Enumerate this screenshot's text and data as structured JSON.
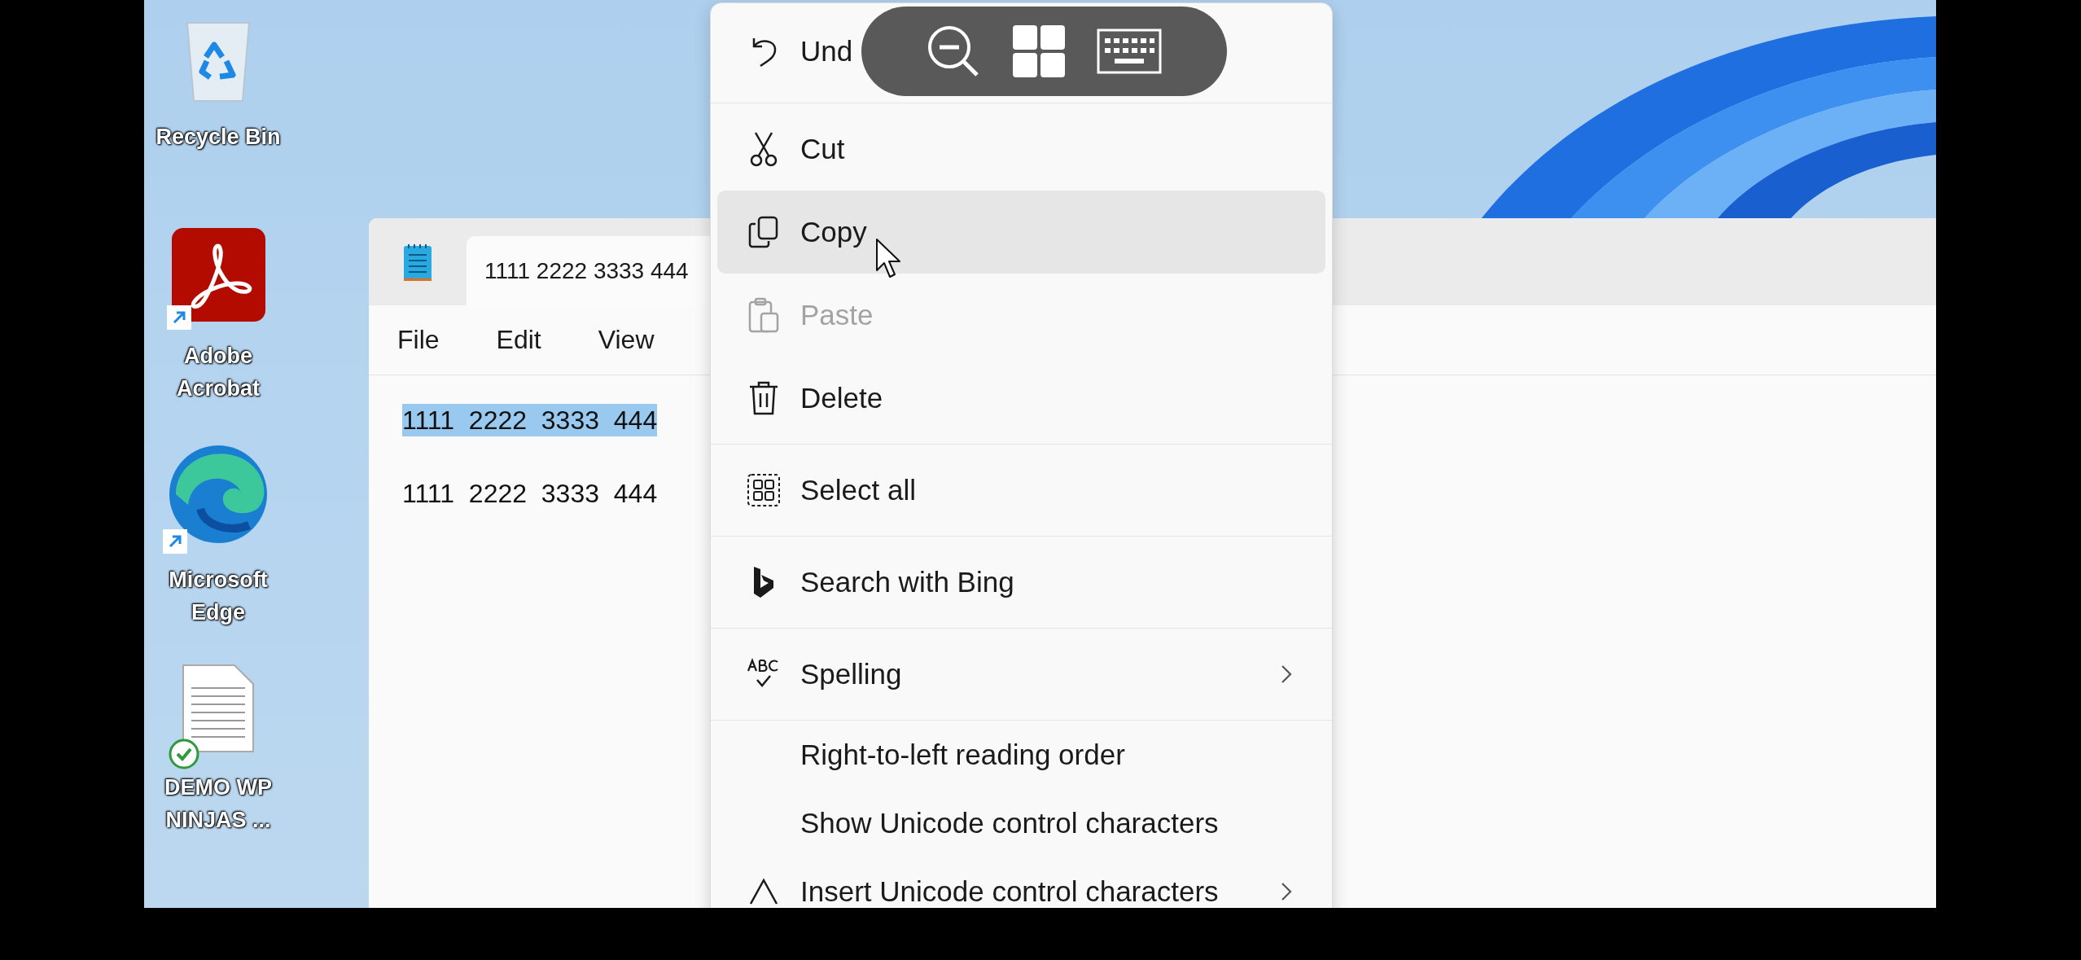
{
  "desktop": {
    "icons": [
      {
        "label": "Recycle Bin"
      },
      {
        "label": "Adobe Acrobat"
      },
      {
        "label": "Microsoft Edge"
      },
      {
        "label": "DEMO WP NINJAS ..."
      }
    ]
  },
  "notepad": {
    "tabs": [
      {
        "label": "1111 2222 3333 444",
        "selected": true
      }
    ],
    "menu": [
      "File",
      "Edit",
      "View"
    ],
    "lines": [
      {
        "text": "1111  2222  3333  444",
        "selected": true
      },
      {
        "text": "1111  2222  3333  444",
        "selected": false
      }
    ]
  },
  "context_menu": {
    "groups": [
      [
        {
          "label": "Und",
          "selected": false,
          "disabled": false,
          "submenu": false
        }
      ],
      [
        {
          "label": "Cut",
          "selected": false,
          "disabled": false,
          "submenu": false
        },
        {
          "label": "Copy",
          "selected": true,
          "disabled": false,
          "submenu": false
        },
        {
          "label": "Paste",
          "selected": false,
          "disabled": true,
          "submenu": false
        },
        {
          "label": "Delete",
          "selected": false,
          "disabled": false,
          "submenu": false
        }
      ],
      [
        {
          "label": "Select all",
          "selected": false,
          "disabled": false,
          "submenu": false
        }
      ],
      [
        {
          "label": "Search with Bing",
          "selected": false,
          "disabled": false,
          "submenu": false
        }
      ],
      [
        {
          "label": "Spelling",
          "selected": false,
          "disabled": false,
          "submenu": true
        }
      ],
      [
        {
          "label": "Right-to-left reading order",
          "selected": false,
          "disabled": false,
          "submenu": false
        },
        {
          "label": "Show Unicode control characters",
          "selected": false,
          "disabled": false,
          "submenu": false
        },
        {
          "label": "Insert Unicode control characters",
          "selected": false,
          "disabled": false,
          "submenu": true
        }
      ]
    ]
  }
}
